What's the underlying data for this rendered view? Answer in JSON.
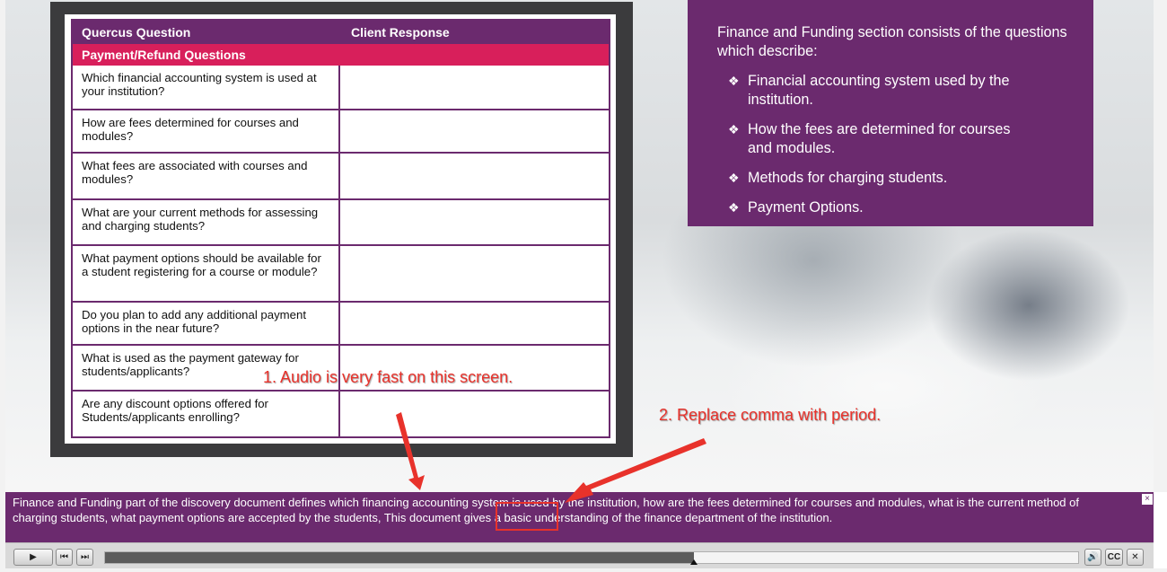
{
  "document": {
    "headers": {
      "question": "Quercus Question",
      "response": "Client Response"
    },
    "section": "Payment/Refund Questions",
    "rows": [
      {
        "question": "Which financial accounting system is used at your institution?",
        "response": ""
      },
      {
        "question": "How are fees determined for courses and modules?",
        "response": ""
      },
      {
        "question": "What fees are associated with courses and modules?",
        "response": ""
      },
      {
        "question": "What are your current methods for assessing and charging students?",
        "response": ""
      },
      {
        "question": "What payment options should be available for a student registering for a course or module?",
        "response": ""
      },
      {
        "question": "Do you plan to add any additional payment options in the near future?",
        "response": ""
      },
      {
        "question": "What is used as the payment gateway for students/applicants?",
        "response": ""
      },
      {
        "question": "Are any discount options offered for Students/applicants enrolling?",
        "response": ""
      }
    ]
  },
  "info": {
    "intro": "Finance and Funding section consists of the questions which describe:",
    "bullet_glyph": "❖",
    "items": [
      "Financial accounting system used by the institution.",
      "How the fees are determined for courses and modules.",
      "Methods for charging students.",
      "Payment Options."
    ]
  },
  "annotations": {
    "note1": "1. Audio is very fast on this screen.",
    "note2": "2. Replace comma with period.",
    "color": "#e8322b"
  },
  "caption": {
    "text": "Finance and Funding part of the discovery document defines which financing accounting system is used by the institution, how are the fees determined for courses and modules, what is the current method of charging students, what payment options are accepted by the students, This document gives a basic understanding of the finance department of the institution.",
    "close_glyph": "×"
  },
  "player": {
    "play_glyph": "▶",
    "prev_glyph": "⏮",
    "next_glyph": "⏭",
    "volume_glyph": "🔊",
    "cc_label": "CC",
    "close_glyph": "✕",
    "progress": 0.605
  },
  "colors": {
    "purple": "#6b2a6e",
    "pink": "#d81f5b",
    "annotation": "#e8322b"
  }
}
